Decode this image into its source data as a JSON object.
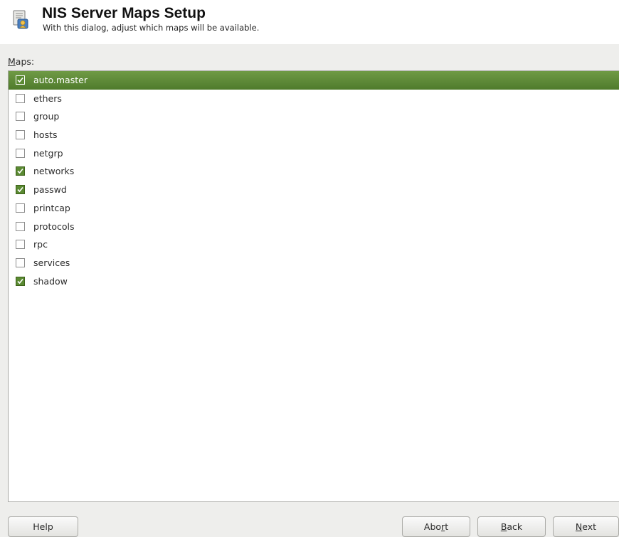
{
  "header": {
    "title": "NIS Server Maps Setup",
    "subtitle": "With this dialog, adjust which maps will be available.",
    "icon": "nis-server-icon"
  },
  "maps": {
    "label": "Maps:",
    "label_mnemonic": "M",
    "label_rest": "aps:",
    "items": [
      {
        "name": "auto.master",
        "checked": true,
        "selected": true
      },
      {
        "name": "ethers",
        "checked": false,
        "selected": false
      },
      {
        "name": "group",
        "checked": false,
        "selected": false
      },
      {
        "name": "hosts",
        "checked": false,
        "selected": false
      },
      {
        "name": "netgrp",
        "checked": false,
        "selected": false
      },
      {
        "name": "networks",
        "checked": true,
        "selected": false
      },
      {
        "name": "passwd",
        "checked": true,
        "selected": false
      },
      {
        "name": "printcap",
        "checked": false,
        "selected": false
      },
      {
        "name": "protocols",
        "checked": false,
        "selected": false
      },
      {
        "name": "rpc",
        "checked": false,
        "selected": false
      },
      {
        "name": "services",
        "checked": false,
        "selected": false
      },
      {
        "name": "shadow",
        "checked": true,
        "selected": false
      }
    ]
  },
  "buttons": {
    "help": {
      "label": "Help"
    },
    "abort": {
      "label": "Abort",
      "before": "Abo",
      "mnemonic": "r",
      "after": "t"
    },
    "back": {
      "label": "Back",
      "before": "",
      "mnemonic": "B",
      "after": "ack"
    },
    "next": {
      "label": "Next",
      "before": "",
      "mnemonic": "N",
      "after": "ext"
    }
  },
  "colors": {
    "selection": "#5a8a32",
    "checked": "#5a8a32",
    "background": "#eeeeec"
  }
}
